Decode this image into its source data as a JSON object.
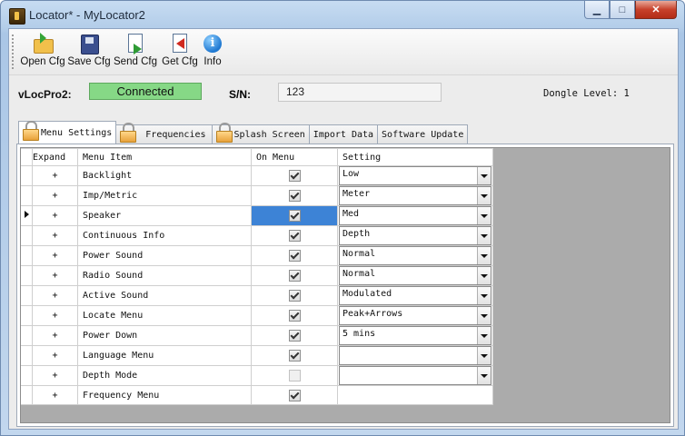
{
  "window": {
    "title": "Locator* - MyLocator2"
  },
  "toolbar": {
    "buttons": [
      {
        "label": "Open Cfg",
        "icon": "open-folder-icon"
      },
      {
        "label": "Save Cfg",
        "icon": "save-disk-icon"
      },
      {
        "label": "Send Cfg",
        "icon": "send-config-icon"
      },
      {
        "label": "Get Cfg",
        "icon": "get-config-icon"
      },
      {
        "label": "Info",
        "icon": "info-icon"
      }
    ]
  },
  "device": {
    "label": "vLocPro2:",
    "status": "Connected",
    "status_color": "#86d886",
    "sn_label": "S/N:",
    "sn_value": "123",
    "dongle_level": "Dongle Level: 1"
  },
  "tabs": [
    {
      "label": "Menu Settings",
      "locked": true,
      "active": true
    },
    {
      "label": "Frequencies",
      "locked": true,
      "active": false
    },
    {
      "label": "Splash Screen",
      "locked": true,
      "active": false
    },
    {
      "label": "Import Data",
      "locked": false,
      "active": false
    },
    {
      "label": "Software Update",
      "locked": false,
      "active": false
    }
  ],
  "grid": {
    "headers": {
      "expand": "Expand",
      "item": "Menu Item",
      "on_menu": "On Menu",
      "setting": "Setting"
    },
    "rows": [
      {
        "expand": "+",
        "item": "Backlight",
        "on_menu": true,
        "setting": "Low",
        "combo": true
      },
      {
        "expand": "+",
        "item": "Imp/Metric",
        "on_menu": true,
        "setting": "Meter",
        "combo": true
      },
      {
        "expand": "+",
        "item": "Speaker",
        "on_menu": true,
        "setting": "Med",
        "combo": true,
        "selected": true
      },
      {
        "expand": "+",
        "item": "Continuous Info",
        "on_menu": true,
        "setting": "Depth",
        "combo": true
      },
      {
        "expand": "+",
        "item": "Power Sound",
        "on_menu": true,
        "setting": "Normal",
        "combo": true
      },
      {
        "expand": "+",
        "item": "Radio Sound",
        "on_menu": true,
        "setting": "Normal",
        "combo": true
      },
      {
        "expand": "+",
        "item": "Active Sound",
        "on_menu": true,
        "setting": "Modulated",
        "combo": true
      },
      {
        "expand": "+",
        "item": "Locate Menu",
        "on_menu": true,
        "setting": "Peak+Arrows",
        "combo": true
      },
      {
        "expand": "+",
        "item": "Power Down",
        "on_menu": true,
        "setting": "5 mins",
        "combo": true
      },
      {
        "expand": "+",
        "item": "Language Menu",
        "on_menu": true,
        "setting": "",
        "combo": true
      },
      {
        "expand": "+",
        "item": "Depth Mode",
        "on_menu": false,
        "setting": "",
        "combo": true
      },
      {
        "expand": "+",
        "item": "Frequency Menu",
        "on_menu": true,
        "setting": "",
        "combo": false
      }
    ]
  }
}
